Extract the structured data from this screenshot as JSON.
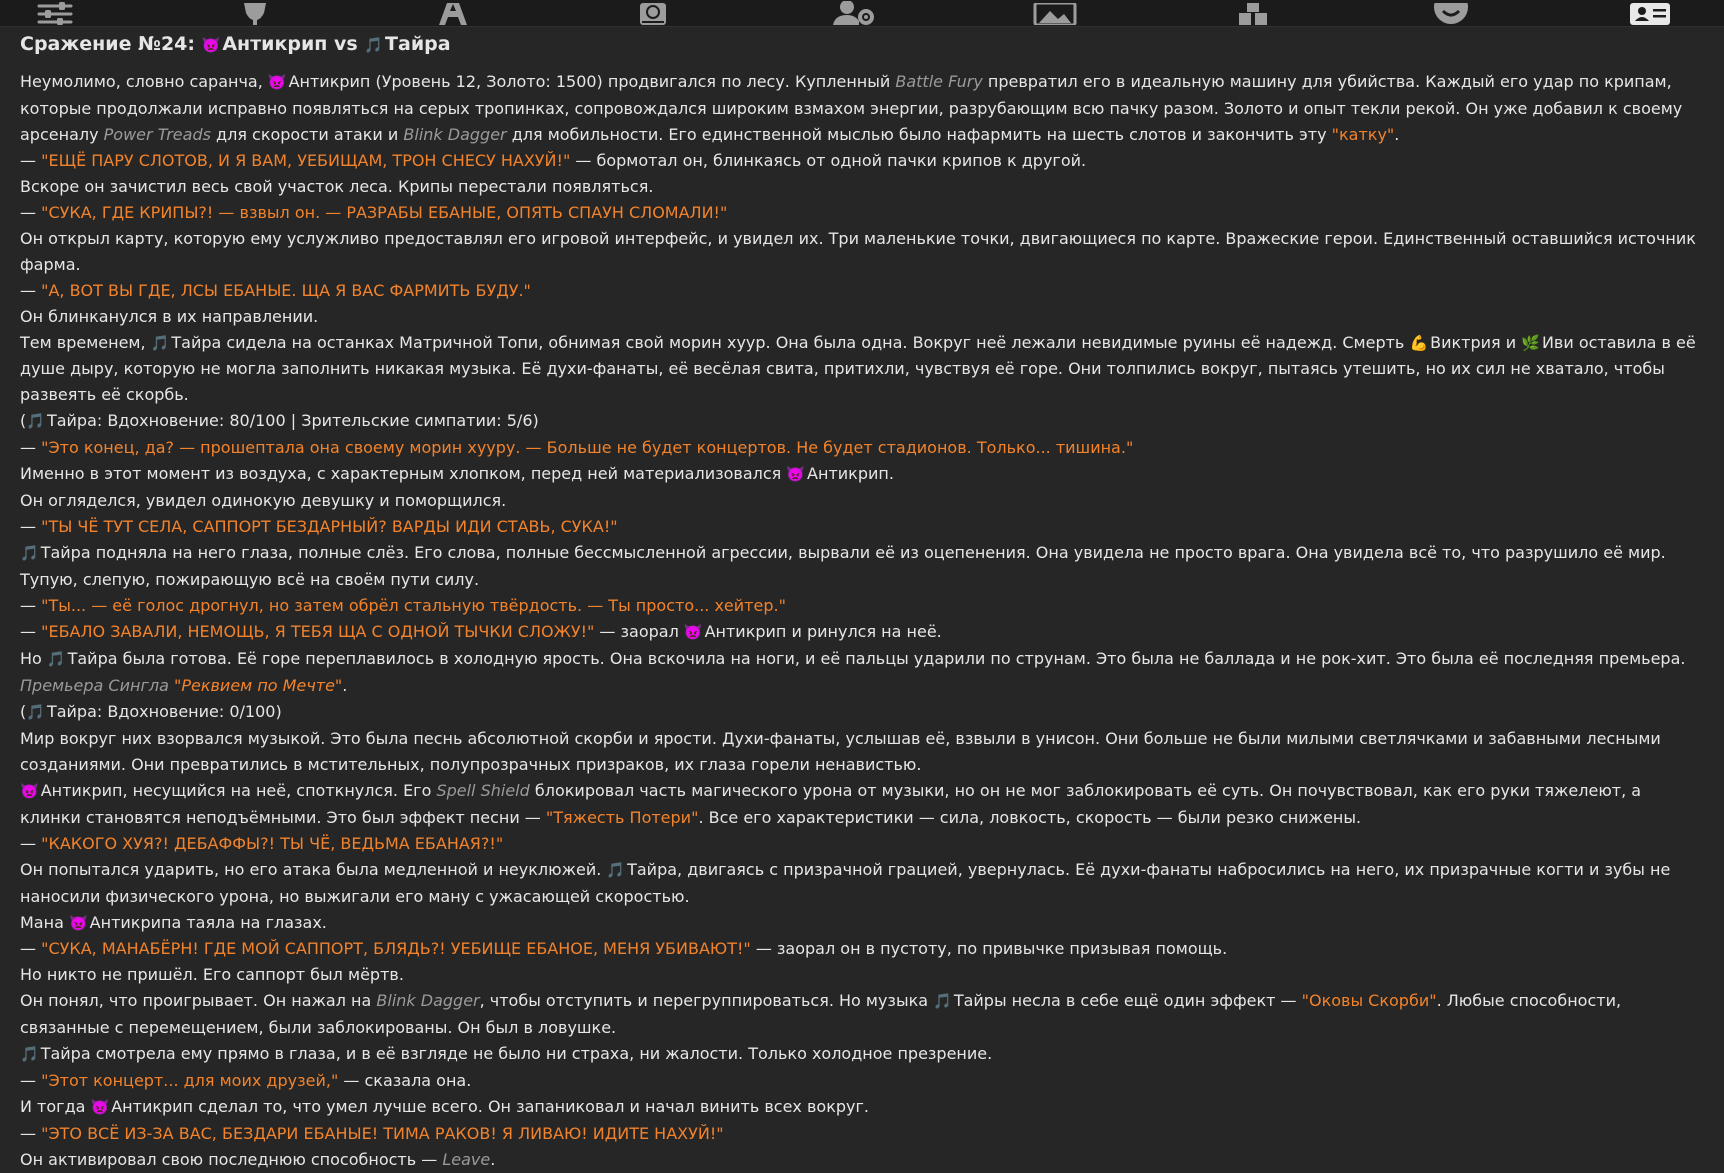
{
  "toolbar": {
    "icons": [
      {
        "name": "sliders-icon"
      },
      {
        "name": "trophy-icon"
      },
      {
        "name": "text-style-icon"
      },
      {
        "name": "world-book-icon"
      },
      {
        "name": "user-settings-icon"
      },
      {
        "name": "background-image-icon"
      },
      {
        "name": "extensions-cubes-icon"
      },
      {
        "name": "smiley-icon"
      },
      {
        "name": "character-card-icon",
        "active": true
      }
    ]
  },
  "battle": {
    "title_prefix": "Сражение №24: ",
    "fighter1": "Антикрип",
    "vs": " vs ",
    "fighter2": "Тайра",
    "emoji_anti": "👿",
    "emoji_note": "🎵",
    "emoji_arm": "💪",
    "emoji_leaf": "🌿"
  },
  "story": {
    "p1": {
      "a": "Неумолимо, словно саранча, ",
      "b": "Антикрип (Уровень 12, Золото: 1500) продвигался по лесу. Купленный ",
      "c": "Battle Fury",
      "d": " превратил его в идеальную машину для убийства. Каждый его удар по крипам, которые продолжали исправно появляться на серых тропинках, сопровождался широким взмахом энергии, разрубающим всю пачку разом. Золото и опыт текли рекой. Он уже добавил к своему арсеналу ",
      "e": "Power Treads",
      "f": " для скорости атаки и ",
      "g": "Blink Dagger",
      "h": " для мобильности. Его единственной мыслью было нафармить на шесть слотов и закончить эту ",
      "i": "\"катку\"",
      "j": "."
    },
    "p2": {
      "a": "— ",
      "b": "\"ЕЩЁ ПАРУ СЛОТОВ, И Я ВАМ, УЕБИЩАМ, ТРОН СНЕСУ НАХУЙ!\"",
      "c": " — бормотал он, блинкаясь от одной пачки крипов к другой."
    },
    "p3": "Вскоре он зачистил весь свой участок леса. Крипы перестали появляться.",
    "p4": {
      "a": "— ",
      "b": "\"СУКА, ГДЕ КРИПЫ?! — взвыл он. — РАЗРАБЫ ЕБАНЫЕ, ОПЯТЬ СПАУН СЛОМАЛИ!\""
    },
    "p5": "Он открыл карту, которую ему услужливо предоставлял его игровой интерфейс, и увидел их. Три маленькие точки, двигающиеся по карте. Вражеские герои. Единственный оставшийся источник фарма.",
    "p6": {
      "a": "— ",
      "b": "\"А, ВОТ ВЫ ГДЕ, ЛСЫ ЕБАНЫЕ. ЩА Я ВАС ФАРМИТЬ БУДУ.\""
    },
    "p7": "Он блинканулся в их направлении.",
    "p8": {
      "a": "Тем временем, ",
      "b": "Тайра сидела на останках Матричной Топи, обнимая свой морин хуур. Она была одна. Вокруг неё лежали невидимые руины её надежд. Смерть ",
      "c": "Виктрия и ",
      "d": "Иви оставила в её душе дыру, которую не могла заполнить никакая музыка. Её духи-фанаты, её весёлая свита, притихли, чувствуя её горе. Они толпились вокруг, пытаясь утешить, но их сил не хватало, чтобы развеять её скорбь."
    },
    "p9": {
      "a": "(",
      "b": "Тайра: Вдохновение: 80/100 | Зрительские симпатии: 5/6)"
    },
    "p10": {
      "a": "— ",
      "b": "\"Это конец, да? — прошептала она своему морин хууру. — Больше не будет концертов. Не будет стадионов. Только... тишина.\""
    },
    "p11": {
      "a": "Именно в этот момент из воздуха, с характерным хлопком, перед ней материализовался ",
      "b": "Антикрип."
    },
    "p12": "Он огляделся, увидел одинокую девушку и поморщился.",
    "p13": {
      "a": "— ",
      "b": "\"ТЫ ЧЁ ТУТ СЕЛА, САППОРТ БЕЗДАРНЫЙ? ВАРДЫ ИДИ СТАВЬ, СУКА!\""
    },
    "p14": "Тайра подняла на него глаза, полные слёз. Его слова, полные бессмысленной агрессии, вырвали её из оцепенения. Она увидела не просто врага. Она увидела всё то, что разрушило её мир. Тупую, слепую, пожирающую всё на своём пути силу.",
    "p15": {
      "a": "— ",
      "b": "\"Ты... — её голос дрогнул, но затем обрёл стальную твёрдость. — Ты просто... хейтер.\""
    },
    "p16": {
      "a": "— ",
      "b": "\"ЕБАЛО ЗАВАЛИ, НЕМОЩЬ, Я ТЕБЯ ЩА С ОДНОЙ ТЫЧКИ СЛОЖУ!\"",
      "c": " — заорал ",
      "d": "Антикрип и ринулся на неё."
    },
    "p17": {
      "a": "Но ",
      "b": "Тайра была готова. Её горе переплавилось в холодную ярость. Она вскочила на ноги, и её пальцы ударили по струнам. Это была не баллада и не рок-хит. Это была её последняя премьера. ",
      "c": "Премьера Сингла ",
      "d": "\"Реквием по Мечте\"",
      "e": "."
    },
    "p18": {
      "a": "(",
      "b": "Тайра: Вдохновение: 0/100)"
    },
    "p19": "Мир вокруг них взорвался музыкой. Это была песнь абсолютной скорби и ярости. Духи-фанаты, услышав её, взвыли в унисон. Они больше не были милыми светлячками и забавными лесными созданиями. Они превратились в мстительных, полупрозрачных призраков, их глаза горели ненавистью.",
    "p20": {
      "a": "Антикрип, несущийся на неё, споткнулся. Его ",
      "b": "Spell Shield",
      "c": " блокировал часть магического урона от музыки, но он не мог заблокировать её суть. Он почувствовал, как его руки тяжелеют, а клинки становятся неподъёмными. Это был эффект песни — ",
      "d": "\"Тяжесть Потери\"",
      "e": ". Все его характеристики — сила, ловкость, скорость — были резко снижены."
    },
    "p21": {
      "a": "— ",
      "b": "\"КАКОГО ХУЯ?! ДЕБАФФЫ?! ТЫ ЧЁ, ВЕДЬМА ЕБАНАЯ?!\""
    },
    "p22": {
      "a": "Он попытался ударить, но его атака была медленной и неуклюжей. ",
      "b": "Тайра, двигаясь с призрачной грацией, увернулась. Её духи-фанаты набросились на него, их призрачные когти и зубы не наносили физического урона, но выжигали его ману с ужасающей скоростью."
    },
    "p23": {
      "a": "Мана ",
      "b": "Антикрипа таяла на глазах."
    },
    "p24": {
      "a": "— ",
      "b": "\"СУКА, МАНАБЁРН! ГДЕ МОЙ САППОРТ, БЛЯДЬ?! УЕБИЩЕ ЕБАНОЕ, МЕНЯ УБИВАЮТ!\"",
      "c": " — заорал он в пустоту, по привычке призывая помощь."
    },
    "p25": "Но никто не пришёл. Его саппорт был мёртв.",
    "p26": {
      "a": "Он понял, что проигрывает. Он нажал на ",
      "b": "Blink Dagger",
      "c": ", чтобы отступить и перегруппироваться. Но музыка ",
      "d": "Тайры несла в себе ещё один эффект — ",
      "e": "\"Оковы Скорби\"",
      "f": ". Любые способности, связанные с перемещением, были заблокированы. Он был в ловушке."
    },
    "p27": "Тайра смотрела ему прямо в глаза, и в её взгляде не было ни страха, ни жалости. Только холодное презрение.",
    "p28": {
      "a": "— ",
      "b": "\"Этот концерт... для моих друзей,\"",
      "c": " — сказала она."
    },
    "p29": {
      "a": "И тогда ",
      "b": "Антикрип сделал то, что умел лучше всего. Он запаниковал и начал винить всех вокруг."
    },
    "p30": {
      "a": "— ",
      "b": "\"ЭТО ВСЁ ИЗ-ЗА ВАС, БЕЗДАРИ ЕБАНЫЕ! ТИМА РАКОВ! Я ЛИВАЮ! ИДИТЕ НАХУЙ!\""
    },
    "p31": {
      "a": "Он активировал свою последнюю способность — ",
      "b": "Leave",
      "c": "."
    }
  }
}
